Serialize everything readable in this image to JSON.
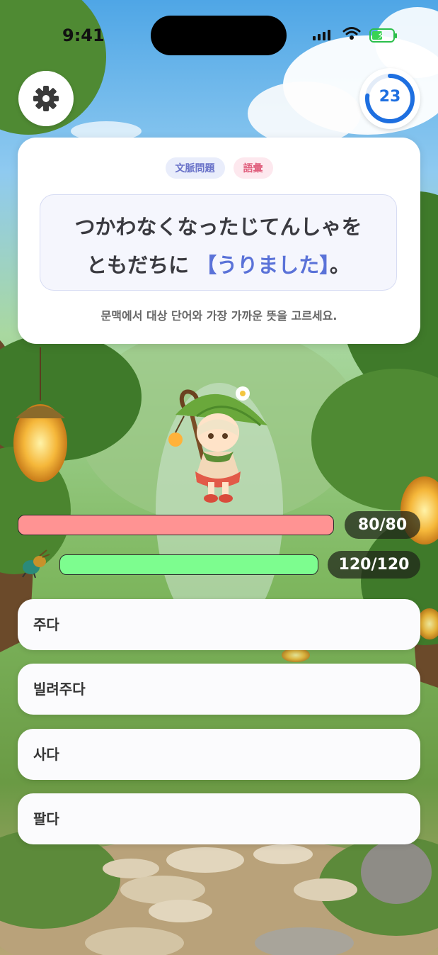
{
  "status_bar": {
    "time": "9:41"
  },
  "timer": {
    "remaining": "23",
    "progress_fraction": 0.77
  },
  "question": {
    "tags": [
      "文脈問題",
      "語彙"
    ],
    "line1": "つかわなくなったじてんしゃを",
    "line2_prefix": "ともだちに",
    "line2_highlight": "【うりました】",
    "line2_suffix": "。",
    "hint": "문맥에서 대상 단어와 가장 가까운 뜻을 고르세요."
  },
  "enemy_hp": {
    "text": "80/80",
    "fraction": 1.0
  },
  "player_hp": {
    "text": "120/120",
    "fraction": 1.0
  },
  "options": [
    "주다",
    "빌려주다",
    "사다",
    "팔다"
  ],
  "colors": {
    "enemy_bar": "#ff9393",
    "player_bar": "#7dfd8f",
    "accent": "#5a72d8",
    "timer_ring": "#1e6fe0"
  },
  "icons": {
    "settings": "gear-icon",
    "timer": "timer-ring",
    "player": "beetle-icon"
  }
}
